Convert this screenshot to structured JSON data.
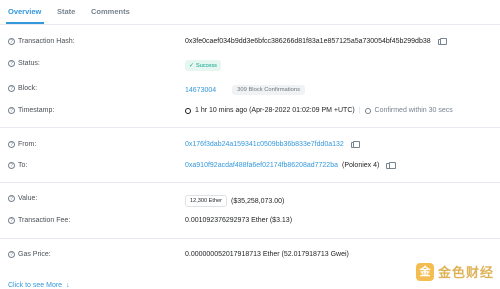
{
  "tabs": [
    {
      "label": "Overview"
    },
    {
      "label": "State"
    },
    {
      "label": "Comments"
    }
  ],
  "fields": {
    "tx_hash": {
      "label": "Transaction Hash:",
      "value": "0x3fe0caef034b9dd3e6bfcc386266d81f83a1e857125a5a730054bf45b299db38"
    },
    "status": {
      "label": "Status:",
      "value": "Success"
    },
    "block": {
      "label": "Block:",
      "value": "14673004",
      "confirmations": "309 Block Confirmations"
    },
    "timestamp": {
      "label": "Timestamp:",
      "value": "1 hr 10 mins ago (Apr-28-2022 01:02:09 PM +UTC)",
      "confirm_text": "Confirmed within 30 secs"
    },
    "from": {
      "label": "From:",
      "value": "0x176f3dab24a159341c0509bb36b833e7fdd0a132"
    },
    "to": {
      "label": "To:",
      "value": "0xa910f92acdaf488fa6ef02174fb86208ad7722ba",
      "name": "(Poloniex 4)"
    },
    "value": {
      "label": "Value:",
      "amount": "12,300 Ether",
      "usd": "($35,258,073.00)"
    },
    "fee": {
      "label": "Transaction Fee:",
      "value": "0.001092376292973 Ether ($3.13)"
    },
    "gas": {
      "label": "Gas Price:",
      "value": "0.000000052017918713 Ether (52.017918713 Gwei)"
    }
  },
  "more": {
    "label": "Click to see More",
    "arrow": "↓"
  },
  "watermark": {
    "logo": "金",
    "text": "金色财经"
  },
  "icons": {
    "help": "?",
    "check": "✓",
    "copy": "copy-icon",
    "clock": "clock-icon"
  },
  "colors": {
    "link": "#3498db",
    "success": "#00a186",
    "muted": "#77838f"
  }
}
